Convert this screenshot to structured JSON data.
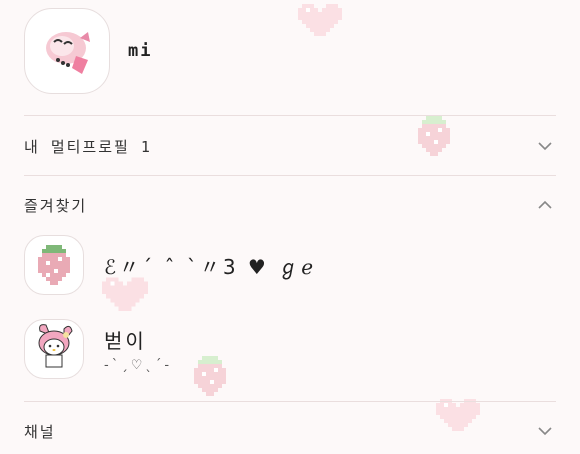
{
  "profile": {
    "name": "mi"
  },
  "sections": {
    "multi_profile": {
      "label": "내 멀티프로필 1",
      "state": "collapsed"
    },
    "favorites": {
      "label": "즐겨찾기",
      "state": "expanded"
    },
    "channel": {
      "label": "채널",
      "state": "collapsed"
    }
  },
  "favorites": [
    {
      "name": "ℰ〃´ ˆ ˋ〃3 ♥ ℊℯ",
      "status": "",
      "icon": "strawberry-avatar"
    },
    {
      "name": "벋이",
      "status": "-ˋˏ♡ˎˊ-",
      "icon": "my-melody-avatar"
    }
  ],
  "colors": {
    "background": "#fdf9f9",
    "divider": "#eadede",
    "heart": "#fbe0e4",
    "strawberry": "#f6d3d8",
    "leaf": "#d7efcf"
  }
}
